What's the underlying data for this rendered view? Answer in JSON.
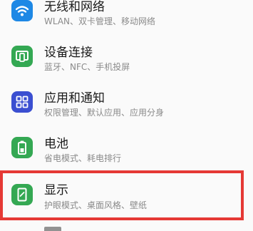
{
  "settings": {
    "items": [
      {
        "title": "无线和网络",
        "subtitle": "WLAN、双卡管理、移动网络",
        "icon": "wifi-icon",
        "color": "#1e88e5"
      },
      {
        "title": "设备连接",
        "subtitle": "蓝牙、NFC、手机投屏",
        "icon": "device-connection-icon",
        "color": "#34a853"
      },
      {
        "title": "应用和通知",
        "subtitle": "权限管理、默认应用、应用分身",
        "icon": "apps-grid-icon",
        "color": "#3b4fd1"
      },
      {
        "title": "电池",
        "subtitle": "省电模式、耗电排行",
        "icon": "battery-icon",
        "color": "#34a853"
      },
      {
        "title": "显示",
        "subtitle": "护眼模式、桌面风格、壁纸",
        "icon": "display-icon",
        "color": "#34a853"
      }
    ]
  }
}
